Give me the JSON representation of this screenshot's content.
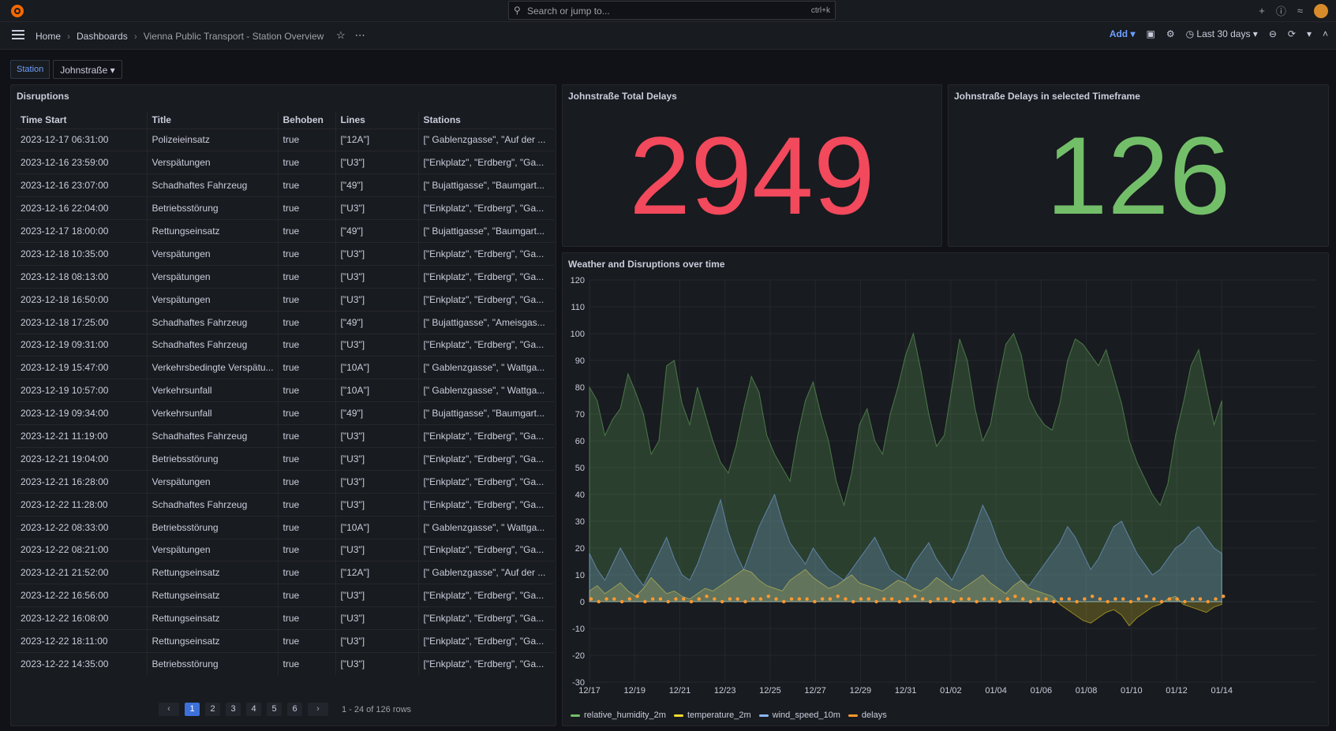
{
  "topbar": {
    "search_placeholder": "Search or jump to...",
    "search_shortcut": "ctrl+k",
    "plus_label": "+"
  },
  "nav": {
    "breadcrumbs": [
      "Home",
      "Dashboards",
      "Vienna Public Transport - Station Overview"
    ],
    "add_label": "Add",
    "time_range": "Last 30 days"
  },
  "variable": {
    "label": "Station",
    "value": "Johnstraße"
  },
  "disruptions": {
    "title": "Disruptions",
    "columns": [
      "Time Start",
      "Title",
      "Behoben",
      "Lines",
      "Stations"
    ],
    "rows": [
      [
        "2023-12-17 06:31:00",
        "Polizeieinsatz",
        "true",
        "[\"12A\"]",
        "[\" Gablenzgasse\", \"Auf der ..."
      ],
      [
        "2023-12-16 23:59:00",
        "Verspätungen",
        "true",
        "[\"U3\"]",
        "[\"Enkplatz\", \"Erdberg\", \"Ga..."
      ],
      [
        "2023-12-16 23:07:00",
        "Schadhaftes Fahrzeug",
        "true",
        "[\"49\"]",
        "[\" Bujattigasse\", \"Baumgart..."
      ],
      [
        "2023-12-16 22:04:00",
        "Betriebsstörung",
        "true",
        "[\"U3\"]",
        "[\"Enkplatz\", \"Erdberg\", \"Ga..."
      ],
      [
        "2023-12-17 18:00:00",
        "Rettungseinsatz",
        "true",
        "[\"49\"]",
        "[\" Bujattigasse\", \"Baumgart..."
      ],
      [
        "2023-12-18 10:35:00",
        "Verspätungen",
        "true",
        "[\"U3\"]",
        "[\"Enkplatz\", \"Erdberg\", \"Ga..."
      ],
      [
        "2023-12-18 08:13:00",
        "Verspätungen",
        "true",
        "[\"U3\"]",
        "[\"Enkplatz\", \"Erdberg\", \"Ga..."
      ],
      [
        "2023-12-18 16:50:00",
        "Verspätungen",
        "true",
        "[\"U3\"]",
        "[\"Enkplatz\", \"Erdberg\", \"Ga..."
      ],
      [
        "2023-12-18 17:25:00",
        "Schadhaftes Fahrzeug",
        "true",
        "[\"49\"]",
        "[\" Bujattigasse\", \"Ameisgas..."
      ],
      [
        "2023-12-19 09:31:00",
        "Schadhaftes Fahrzeug",
        "true",
        "[\"U3\"]",
        "[\"Enkplatz\", \"Erdberg\", \"Ga..."
      ],
      [
        "2023-12-19 15:47:00",
        "Verkehrsbedingte Verspätu...",
        "true",
        "[\"10A\"]",
        "[\" Gablenzgasse\", \" Wattga..."
      ],
      [
        "2023-12-19 10:57:00",
        "Verkehrsunfall",
        "true",
        "[\"10A\"]",
        "[\" Gablenzgasse\", \" Wattga..."
      ],
      [
        "2023-12-19 09:34:00",
        "Verkehrsunfall",
        "true",
        "[\"49\"]",
        "[\" Bujattigasse\", \"Baumgart..."
      ],
      [
        "2023-12-21 11:19:00",
        "Schadhaftes Fahrzeug",
        "true",
        "[\"U3\"]",
        "[\"Enkplatz\", \"Erdberg\", \"Ga..."
      ],
      [
        "2023-12-21 19:04:00",
        "Betriebsstörung",
        "true",
        "[\"U3\"]",
        "[\"Enkplatz\", \"Erdberg\", \"Ga..."
      ],
      [
        "2023-12-21 16:28:00",
        "Verspätungen",
        "true",
        "[\"U3\"]",
        "[\"Enkplatz\", \"Erdberg\", \"Ga..."
      ],
      [
        "2023-12-22 11:28:00",
        "Schadhaftes Fahrzeug",
        "true",
        "[\"U3\"]",
        "[\"Enkplatz\", \"Erdberg\", \"Ga..."
      ],
      [
        "2023-12-22 08:33:00",
        "Betriebsstörung",
        "true",
        "[\"10A\"]",
        "[\" Gablenzgasse\", \" Wattga..."
      ],
      [
        "2023-12-22 08:21:00",
        "Verspätungen",
        "true",
        "[\"U3\"]",
        "[\"Enkplatz\", \"Erdberg\", \"Ga..."
      ],
      [
        "2023-12-21 21:52:00",
        "Rettungseinsatz",
        "true",
        "[\"12A\"]",
        "[\" Gablenzgasse\", \"Auf der ..."
      ],
      [
        "2023-12-22 16:56:00",
        "Rettungseinsatz",
        "true",
        "[\"U3\"]",
        "[\"Enkplatz\", \"Erdberg\", \"Ga..."
      ],
      [
        "2023-12-22 16:08:00",
        "Rettungseinsatz",
        "true",
        "[\"U3\"]",
        "[\"Enkplatz\", \"Erdberg\", \"Ga..."
      ],
      [
        "2023-12-22 18:11:00",
        "Rettungseinsatz",
        "true",
        "[\"U3\"]",
        "[\"Enkplatz\", \"Erdberg\", \"Ga..."
      ],
      [
        "2023-12-22 14:35:00",
        "Betriebsstörung",
        "true",
        "[\"U3\"]",
        "[\"Enkplatz\", \"Erdberg\", \"Ga..."
      ]
    ],
    "pages": [
      "1",
      "2",
      "3",
      "4",
      "5",
      "6"
    ],
    "current_page": "1",
    "row_summary": "1 - 24 of 126 rows"
  },
  "stat_total": {
    "title": "Johnstraße Total Delays",
    "value": "2949",
    "color": "#f2495c"
  },
  "stat_timeframe": {
    "title": "Johnstraße Delays in selected Timeframe",
    "value": "126",
    "color": "#73bf69"
  },
  "chart_data": {
    "type": "area",
    "title": "Weather and Disruptions over time",
    "ylim": [
      -30,
      120
    ],
    "yticks": [
      120,
      110,
      100,
      90,
      80,
      70,
      60,
      50,
      40,
      30,
      20,
      10,
      0,
      -10,
      -20,
      -30
    ],
    "xticks": [
      "12/17",
      "12/19",
      "12/21",
      "12/23",
      "12/25",
      "12/27",
      "12/29",
      "12/31",
      "01/02",
      "01/04",
      "01/06",
      "01/08",
      "01/10",
      "01/12",
      "01/14"
    ],
    "grid": true,
    "legend_position": "bottom-left",
    "series": [
      {
        "name": "relative_humidity_2m",
        "color": "#73bf69",
        "kind": "area",
        "values": [
          80,
          75,
          62,
          68,
          72,
          85,
          78,
          70,
          55,
          60,
          88,
          90,
          74,
          66,
          80,
          70,
          60,
          52,
          48,
          58,
          72,
          84,
          78,
          62,
          55,
          50,
          45,
          62,
          75,
          82,
          70,
          60,
          45,
          36,
          48,
          66,
          72,
          60,
          55,
          70,
          80,
          92,
          100,
          86,
          70,
          58,
          62,
          80,
          98,
          90,
          72,
          60,
          66,
          82,
          96,
          100,
          92,
          76,
          70,
          66,
          64,
          74,
          90,
          98,
          96,
          92,
          88,
          94,
          84,
          74,
          60,
          52,
          46,
          40,
          36,
          44,
          62,
          74,
          88,
          94,
          80,
          66,
          75
        ]
      },
      {
        "name": "temperature_2m",
        "color": "#fade2a",
        "kind": "area",
        "values": [
          4,
          6,
          3,
          5,
          7,
          4,
          2,
          5,
          9,
          6,
          3,
          4,
          2,
          1,
          3,
          5,
          4,
          6,
          8,
          10,
          12,
          11,
          8,
          6,
          5,
          4,
          8,
          10,
          12,
          9,
          7,
          5,
          6,
          8,
          10,
          7,
          6,
          5,
          4,
          6,
          8,
          7,
          5,
          4,
          6,
          9,
          7,
          5,
          4,
          6,
          8,
          10,
          7,
          5,
          3,
          6,
          8,
          5,
          4,
          3,
          2,
          -1,
          -3,
          -5,
          -7,
          -8,
          -6,
          -4,
          -3,
          -5,
          -9,
          -6,
          -4,
          -2,
          -1,
          1,
          2,
          -1,
          -2,
          -3,
          -4,
          -2,
          -1
        ]
      },
      {
        "name": "wind_speed_10m",
        "color": "#8ab8ff",
        "kind": "area",
        "values": [
          18,
          12,
          8,
          14,
          20,
          15,
          10,
          6,
          12,
          18,
          24,
          16,
          10,
          8,
          14,
          22,
          30,
          38,
          26,
          18,
          12,
          20,
          28,
          34,
          40,
          30,
          22,
          18,
          14,
          20,
          16,
          12,
          10,
          8,
          12,
          16,
          20,
          24,
          18,
          12,
          10,
          8,
          14,
          18,
          22,
          16,
          12,
          8,
          14,
          20,
          28,
          36,
          30,
          22,
          16,
          12,
          8,
          6,
          10,
          14,
          18,
          22,
          28,
          24,
          18,
          12,
          16,
          22,
          28,
          30,
          24,
          18,
          14,
          10,
          12,
          16,
          20,
          22,
          26,
          28,
          24,
          20,
          18
        ]
      },
      {
        "name": "delays",
        "color": "#ff9830",
        "kind": "points",
        "values": [
          1,
          0,
          1,
          1,
          0,
          1,
          2,
          0,
          1,
          1,
          0,
          1,
          1,
          0,
          1,
          2,
          1,
          0,
          1,
          1,
          0,
          1,
          1,
          2,
          1,
          0,
          1,
          1,
          1,
          0,
          1,
          1,
          2,
          1,
          0,
          1,
          1,
          0,
          1,
          1,
          0,
          1,
          2,
          1,
          0,
          1,
          1,
          0,
          1,
          1,
          0,
          1,
          1,
          0,
          1,
          2,
          1,
          0,
          1,
          1,
          0,
          1,
          1,
          0,
          1,
          2,
          1,
          0,
          1,
          1,
          0,
          1,
          2,
          1,
          0,
          1,
          1,
          0,
          1,
          1,
          0,
          1,
          2
        ]
      }
    ]
  }
}
